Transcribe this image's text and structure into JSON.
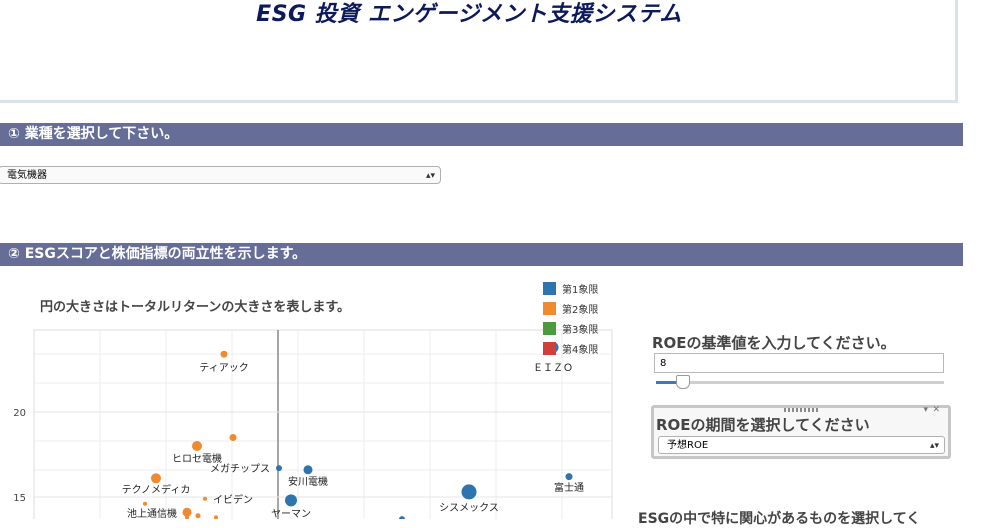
{
  "app": {
    "title": "ESG 投資 エンゲージメント支援システム"
  },
  "section1": {
    "title": "①  業種を選択して下さい。"
  },
  "industry_select": {
    "value": "電気機器"
  },
  "section2": {
    "title": "②  ESGスコアと株価指標の両立性を示します。"
  },
  "chart_caption": "円の大きさはトータルリターンの大きさを表します。",
  "colors": {
    "q1": "#2e75b0",
    "q2": "#f08a30",
    "q3": "#4c9a3e",
    "q4": "#d0403a",
    "section_bar": "#666e98",
    "title": "#0c1a5a"
  },
  "chart_data": {
    "type": "scatter",
    "legend": [
      {
        "name": "第1象限",
        "color": "#2e75b0"
      },
      {
        "name": "第2象限",
        "color": "#f08a30"
      },
      {
        "name": "第3象限",
        "color": "#4c9a3e"
      },
      {
        "name": "第4象限",
        "color": "#d0403a"
      }
    ],
    "yticks": [
      20,
      15
    ],
    "y_range_visible": [
      12.9,
      24.8
    ],
    "reference_line": "ROE基準値",
    "grid": true,
    "points": [
      {
        "label": "ティアック",
        "quadrant": 2,
        "y": 23.4
      },
      {
        "label": "ＥＩＺＯ",
        "quadrant": 1,
        "y": 23.8
      },
      {
        "label": "",
        "quadrant": 2,
        "y": 18.5
      },
      {
        "label": "ヒロセ電機",
        "quadrant": 2,
        "y": 18.0
      },
      {
        "label": "メガチップス",
        "quadrant": 1,
        "y": 16.7
      },
      {
        "label": "安川電機",
        "quadrant": 1,
        "y": 16.6
      },
      {
        "label": "富士通",
        "quadrant": 1,
        "y": 16.2
      },
      {
        "label": "テクノメディカ",
        "quadrant": 2,
        "y": 16.1
      },
      {
        "label": "シスメックス",
        "quadrant": 1,
        "y": 15.3
      },
      {
        "label": "イビデン",
        "quadrant": 2,
        "y": 14.9
      },
      {
        "label": "ヤーマン",
        "quadrant": 1,
        "y": 14.8
      },
      {
        "label": "池上通信機",
        "quadrant": 2,
        "y": 14.1
      },
      {
        "label": "",
        "quadrant": 2,
        "y": 14.6
      },
      {
        "label": "",
        "quadrant": 2,
        "y": 13.9
      },
      {
        "label": "",
        "quadrant": 2,
        "y": 13.8
      },
      {
        "label": "",
        "quadrant": 2,
        "y": 13.8
      },
      {
        "label": "",
        "quadrant": 1,
        "y": 13.7
      }
    ]
  },
  "roe_base": {
    "label": "ROEの基準値を入力してください。",
    "value": "8",
    "slider_fraction": 0.09
  },
  "roe_period": {
    "label": "ROEの期間を選択してください",
    "value": "予想ROE"
  },
  "esg_prompt": "ESGの中で特に関心があるものを選択してく"
}
